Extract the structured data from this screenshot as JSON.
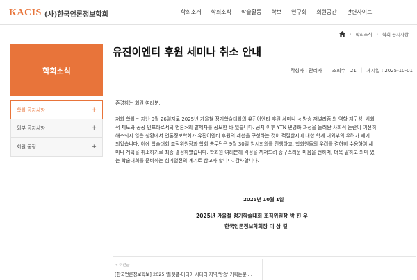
{
  "header": {
    "logo_mark": "KACIS",
    "logo_text": "(사)한국언론정보학회",
    "nav": [
      "학회소개",
      "학회소식",
      "학술활동",
      "학보",
      "연구회",
      "회원공간",
      "관련사이트"
    ]
  },
  "breadcrumb": {
    "level1": "학회소식",
    "level2": "학회 공지사항"
  },
  "sidebar": {
    "title": "학회소식",
    "items": [
      {
        "label": "학회 공지사항",
        "active": true
      },
      {
        "label": "외부 공지사항",
        "active": false
      },
      {
        "label": "회원 동정",
        "active": false
      }
    ]
  },
  "post": {
    "title": "유진이엔티 후원 세미나 취소 안내",
    "author": "작성자 : 관리자",
    "views": "조회수 : 21",
    "date": "게시일 : 2025-10-01",
    "greeting": "존경하는 회원 여러분,",
    "body_lines": [
      "저희 학회는 지난 9월 26일자로 2025년 가을철 정기학술대회의 유진이엔티 후원 세미나 <'방송 저널리즘'의 역할 재구성: 사회",
      "적 제도와 공공 인프라로서의 언론>의 발제자를 공모한 바 있습니다. 공지 이후 YTN 민영화 과정을 둘러싼 사회적 논란이 여전히",
      "해소되지 않은 상황에서 언론정보학회가 유진이엔티 후원의 세션을 구성하는 것이 적절한지에 대한 학계 내외부의 우려가 제기",
      "되었습니다. 이에 학술대회 조직위원장과 학회 총무단은 9월 30일 임시회의를 진행하고, 학회원들의 우려를 겸허히 수용하여 세",
      "미나 계획을 취소하기로 최종 결정하였습니다. 학회원 여러분께 걱정을 끼쳐드려 송구스러운 마음을 전하며, 더욱 말하고 의미 있",
      "는 학술대회를 준비하는 심기일전의 계기로 삼고자 합니다. 감사합니다."
    ],
    "sign_date": "2025년 10월 1일",
    "sign_line1": "2025년 가을철 정기학술대회 조직위원장   박 진 우",
    "sign_line2": "한국언론정보학회장   이 상 길"
  },
  "prev": {
    "label": "< 이전글",
    "title": "[한국언론정보학보] 2025 '플랫폼-미디어 시대의 지역/방송' 기획논문 ..."
  },
  "colors": {
    "accent": "#e8743a"
  }
}
